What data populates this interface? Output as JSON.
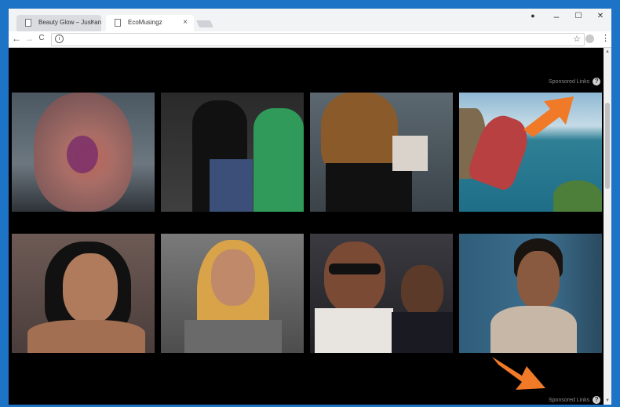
{
  "tabs": [
    {
      "title": "Beauty Glow – Just anoth",
      "close": "×"
    },
    {
      "title": "EcoMusingz",
      "close": "×"
    }
  ],
  "window_controls": {
    "profile": "●",
    "minimize": "–",
    "maximize": "☐",
    "close": "✕"
  },
  "toolbar": {
    "back": "←",
    "forward": "→",
    "reload": "C",
    "info": "i",
    "star": "☆",
    "menu": "⋮"
  },
  "page": {
    "sponsored_top": "Sponsored Links",
    "sponsored_bottom": "Sponsored Links",
    "help": "?"
  },
  "colors": {
    "background": "#000000",
    "arrow": "#f07a28",
    "frame": "#1d73c6"
  }
}
